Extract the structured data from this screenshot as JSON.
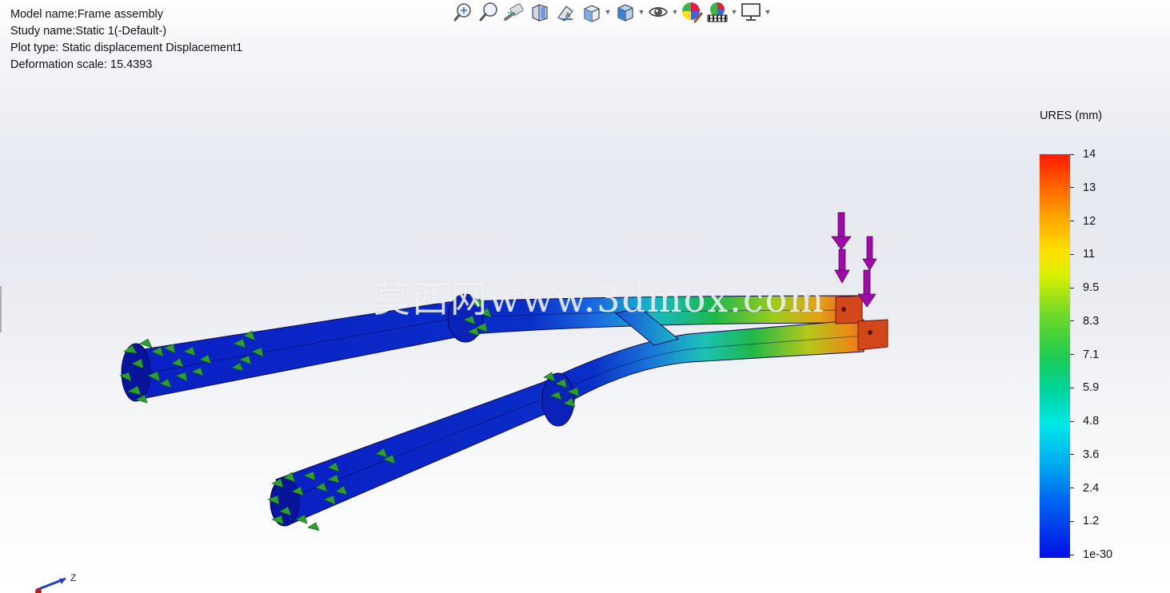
{
  "info": {
    "model_name": "Model name:Frame assembly",
    "study_name": "Study name:Static 1(-Default-)",
    "plot_type": "Plot type: Static displacement Displacement1",
    "deformation_scale": "Deformation scale: 15.4393"
  },
  "toolbar": {
    "buttons": [
      {
        "icon": "zoom-to-fit-icon"
      },
      {
        "icon": "zoom-to-area-icon"
      },
      {
        "icon": "previous-view-icon"
      },
      {
        "icon": "section-view-icon"
      },
      {
        "icon": "dynamic-annotation-icon"
      },
      {
        "icon": "view-orientation-icon"
      },
      {
        "icon": "display-style-icon"
      },
      {
        "icon": "hide-show-items-icon"
      },
      {
        "icon": "edit-appearance-icon"
      },
      {
        "icon": "apply-scene-icon"
      },
      {
        "icon": "view-settings-icon"
      }
    ]
  },
  "legend": {
    "title": "URES (mm)",
    "ticks": [
      "14",
      "13",
      "12",
      "11",
      "9.5",
      "8.3",
      "7.1",
      "5.9",
      "4.8",
      "3.6",
      "2.4",
      "1.2",
      "1e-30"
    ],
    "colors": {
      "max": "#ff1a00",
      "mid": "#1fcc4f",
      "min": "#0010e6"
    }
  },
  "watermark": "莫西网www.3dmox.com",
  "triad": {
    "axis_label": "Z"
  },
  "colors": {
    "beam_low": "#0a1fc4",
    "beam_high": "#e84a10",
    "fixture": "#2f9e2f",
    "load_arrow": "#9a0ea6"
  }
}
